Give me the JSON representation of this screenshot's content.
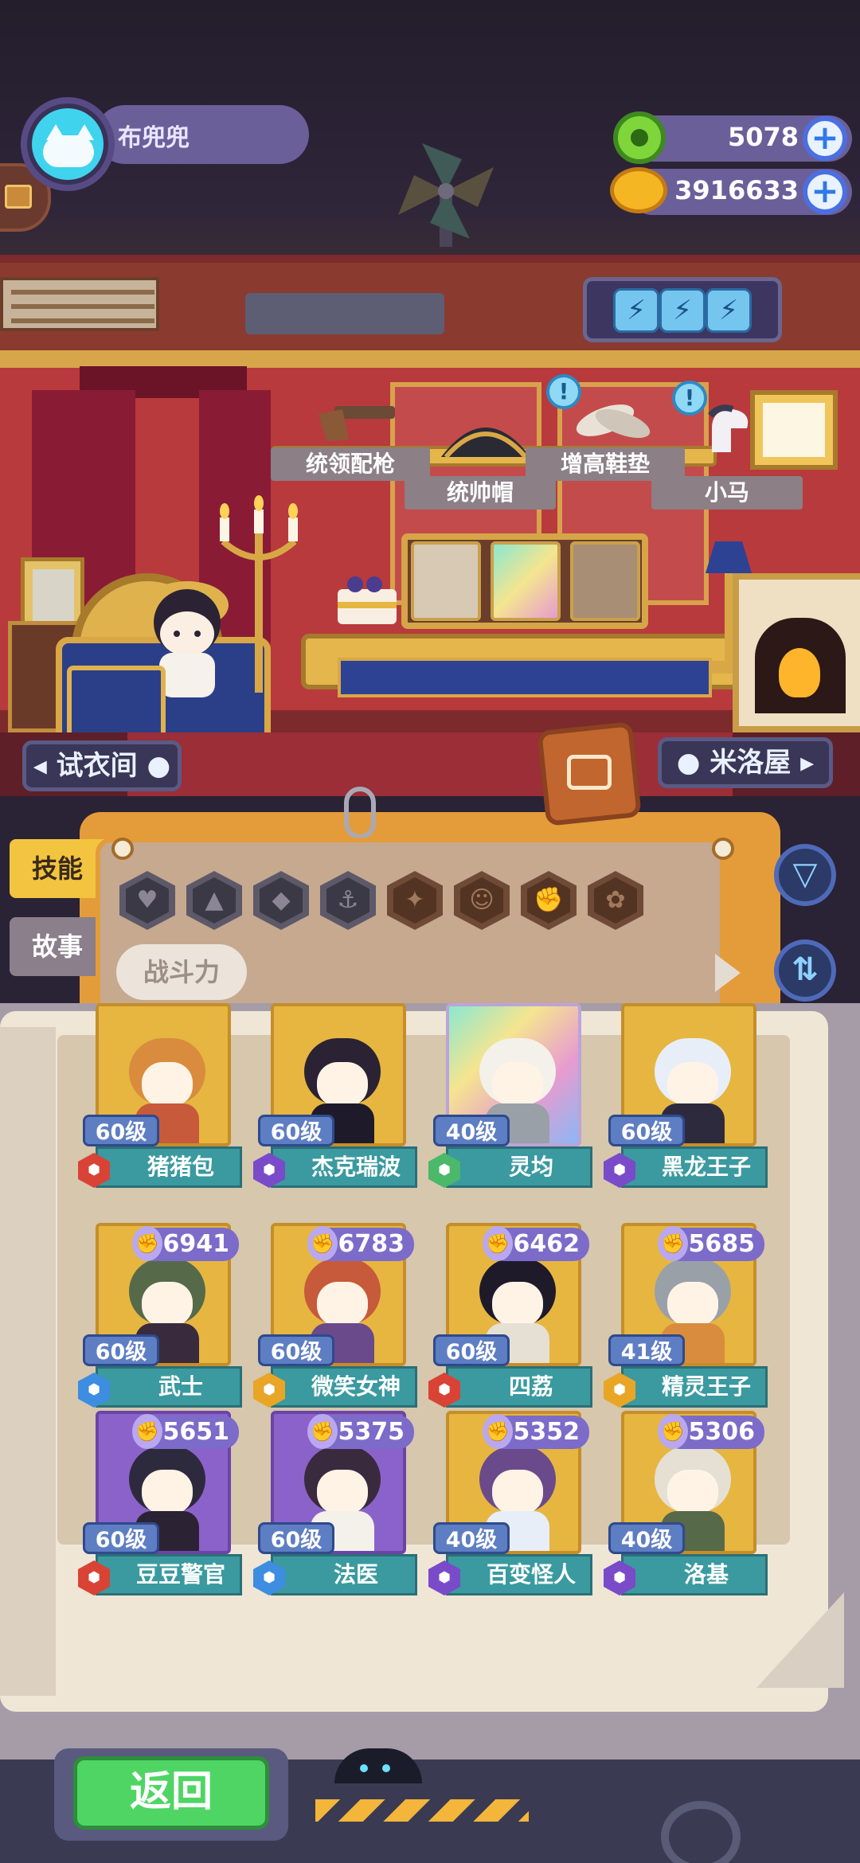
{
  "player": {
    "name": "布兜兜"
  },
  "resources": [
    {
      "name": "green-currency",
      "value": "5078",
      "color": "#7fd63a"
    },
    {
      "name": "gold-planet",
      "value": "3916633",
      "color": "#f5b623"
    }
  ],
  "room": {
    "items": [
      {
        "id": "gun",
        "label": "统领配枪"
      },
      {
        "id": "hat",
        "label": "统帅帽"
      },
      {
        "id": "insole",
        "label": "增高鞋垫"
      },
      {
        "id": "horse",
        "label": "小马"
      }
    ],
    "bubble_icon": "!",
    "nav_left": "◂ 试衣间 ●",
    "nav_right": "● 米洛屋 ▸"
  },
  "tabs": {
    "skill": "技能",
    "story": "故事"
  },
  "filters": {
    "icons": [
      "heart-icon",
      "bomb-icon",
      "shield-icon",
      "anchor-icon",
      "sword-icon",
      "smile-icon",
      "muscle-icon",
      "brain-icon"
    ],
    "glyphs": [
      "♥",
      "▲",
      "◆",
      "⚓",
      "✦",
      "☺",
      "✊",
      "✿"
    ],
    "sort_label": "战斗力"
  },
  "heroes": [
    {
      "name": "猪猪包",
      "level": "60级",
      "power": "",
      "elem_color": "#d94336",
      "art": "gold"
    },
    {
      "name": "杰克瑞波",
      "level": "60级",
      "power": "",
      "elem_color": "#7a4bc9",
      "art": "gold"
    },
    {
      "name": "灵均",
      "level": "40级",
      "power": "",
      "elem_color": "#4bb86a",
      "art": "rainbow"
    },
    {
      "name": "黑龙王子",
      "level": "60级",
      "power": "",
      "elem_color": "#7a4bc9",
      "art": "gold"
    },
    {
      "name": "武士",
      "level": "60级",
      "power": "6941",
      "elem_color": "#3d8de0",
      "art": "gold"
    },
    {
      "name": "微笑女神",
      "level": "60级",
      "power": "6783",
      "elem_color": "#e9a526",
      "art": "gold"
    },
    {
      "name": "四荔",
      "level": "60级",
      "power": "6462",
      "elem_color": "#d94336",
      "art": "gold"
    },
    {
      "name": "精灵王子",
      "level": "41级",
      "power": "5685",
      "elem_color": "#e9a526",
      "art": "gold"
    },
    {
      "name": "豆豆警官",
      "level": "60级",
      "power": "5651",
      "elem_color": "#d94336",
      "art": "purple"
    },
    {
      "name": "法医",
      "level": "60级",
      "power": "5375",
      "elem_color": "#3d8de0",
      "art": "purple"
    },
    {
      "name": "百变怪人",
      "level": "40级",
      "power": "5352",
      "elem_color": "#7a4bc9",
      "art": "gold"
    },
    {
      "name": "洛基",
      "level": "40级",
      "power": "5306",
      "elem_color": "#7a4bc9",
      "art": "gold"
    }
  ],
  "footer": {
    "back_label": "返回"
  },
  "colors": {
    "accent": "#6b5f9a",
    "book": "#efe6d6",
    "folder": "#e49c3a",
    "back_button": "#4fd564"
  }
}
